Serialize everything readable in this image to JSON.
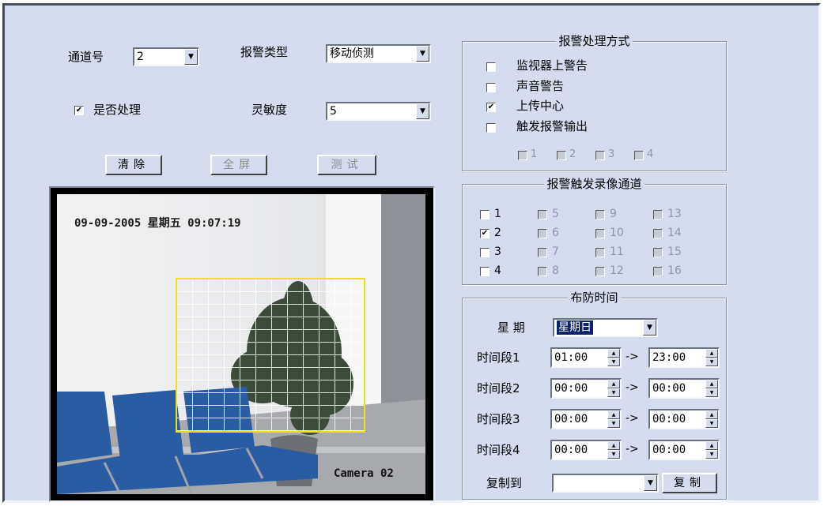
{
  "channel": {
    "label": "通道号",
    "value": "2"
  },
  "alarm_type": {
    "label": "报警类型",
    "value": "移动侦测"
  },
  "handle": {
    "label": "是否处理",
    "checked": true
  },
  "sensitivity": {
    "label": "灵敏度",
    "value": "5"
  },
  "buttons": {
    "clear": "清除",
    "fullscreen": "全屏",
    "test": "测试"
  },
  "video": {
    "timestamp": "09-09-2005 星期五 09:07:19",
    "camera_label": "Camera 02"
  },
  "alarm_handling": {
    "title": "报警处理方式",
    "options": [
      {
        "label": "监视器上警告",
        "checked": false
      },
      {
        "label": "声音警告",
        "checked": false
      },
      {
        "label": "上传中心",
        "checked": true
      },
      {
        "label": "触发报警输出",
        "checked": false
      }
    ],
    "outputs": [
      "1",
      "2",
      "3",
      "4"
    ]
  },
  "record_channels": {
    "title": "报警触发录像通道",
    "channels": [
      {
        "label": "1",
        "checked": false,
        "enabled": true
      },
      {
        "label": "2",
        "checked": true,
        "enabled": true
      },
      {
        "label": "3",
        "checked": false,
        "enabled": true
      },
      {
        "label": "4",
        "checked": false,
        "enabled": true
      },
      {
        "label": "5",
        "checked": false,
        "enabled": false
      },
      {
        "label": "6",
        "checked": false,
        "enabled": false
      },
      {
        "label": "7",
        "checked": false,
        "enabled": false
      },
      {
        "label": "8",
        "checked": false,
        "enabled": false
      },
      {
        "label": "9",
        "checked": false,
        "enabled": false
      },
      {
        "label": "10",
        "checked": false,
        "enabled": false
      },
      {
        "label": "11",
        "checked": false,
        "enabled": false
      },
      {
        "label": "12",
        "checked": false,
        "enabled": false
      },
      {
        "label": "13",
        "checked": false,
        "enabled": false
      },
      {
        "label": "14",
        "checked": false,
        "enabled": false
      },
      {
        "label": "15",
        "checked": false,
        "enabled": false
      },
      {
        "label": "16",
        "checked": false,
        "enabled": false
      }
    ]
  },
  "schedule": {
    "title": "布防时间",
    "weekday_label": "星 期",
    "weekday_value": "星期日",
    "arrow": "->",
    "segments": [
      {
        "label": "时间段1",
        "start": "01:00",
        "end": "23:00"
      },
      {
        "label": "时间段2",
        "start": "00:00",
        "end": "00:00"
      },
      {
        "label": "时间段3",
        "start": "00:00",
        "end": "00:00"
      },
      {
        "label": "时间段4",
        "start": "00:00",
        "end": "00:00"
      }
    ],
    "copy_to_label": "复制到",
    "copy_to_value": "",
    "copy_button": "复制"
  },
  "colors": {
    "background": "#d4dcee",
    "motion_region": "#f0e01e",
    "selection": "#0a246a"
  }
}
